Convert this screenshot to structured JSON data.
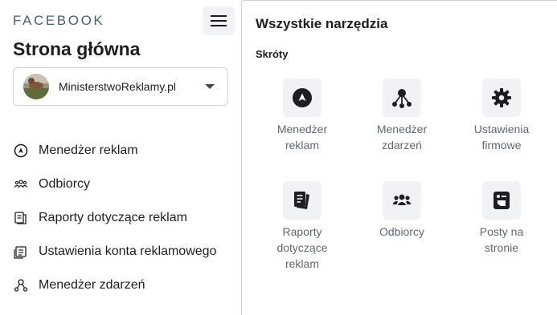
{
  "brand": "FACEBOOK",
  "header": {
    "page_title": "Strona główna"
  },
  "account": {
    "name": "MinisterstwoReklamy.pl"
  },
  "nav": {
    "items": [
      {
        "label": "Menedżer reklam",
        "icon": "ads-manager-icon"
      },
      {
        "label": "Odbiorcy",
        "icon": "audiences-icon"
      },
      {
        "label": "Raporty dotyczące reklam",
        "icon": "ads-reports-icon"
      },
      {
        "label": "Ustawienia konta reklamowego",
        "icon": "ad-account-settings-icon"
      },
      {
        "label": "Menedżer zdarzeń",
        "icon": "events-manager-icon"
      }
    ]
  },
  "tools_panel": {
    "title": "Wszystkie narzędzia",
    "section_shortcuts": "Skróty",
    "tools": [
      {
        "line1": "Menedżer",
        "line2": "reklam",
        "line3": "",
        "icon": "ads-manager-icon"
      },
      {
        "line1": "Menedżer",
        "line2": "zdarzeń",
        "line3": "",
        "icon": "events-manager-icon"
      },
      {
        "line1": "Ustawienia",
        "line2": "firmowe",
        "line3": "",
        "icon": "gear-icon"
      },
      {
        "line1": "Raporty",
        "line2": "dotyczące",
        "line3": "reklam",
        "icon": "reports-icon"
      },
      {
        "line1": "Odbiorcy",
        "line2": "",
        "line3": "",
        "icon": "audiences-icon"
      },
      {
        "line1": "Posty na",
        "line2": "stronie",
        "line3": "",
        "icon": "page-posts-icon"
      }
    ]
  },
  "colors": {
    "icon_dark": "#1c1e21",
    "tool_bg": "#f0f2f5",
    "brand": "#4b5f72",
    "muted_text": "#606770"
  }
}
